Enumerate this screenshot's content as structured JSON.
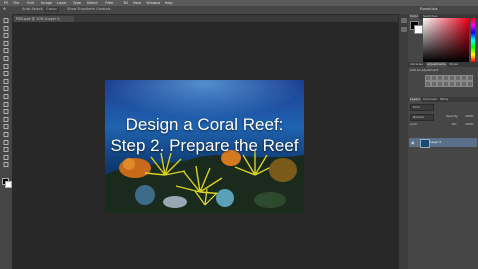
{
  "app": {
    "menu_items": [
      "PS",
      "File",
      "Edit",
      "Image",
      "Layer",
      "Type",
      "Select",
      "Filter",
      "3D",
      "View",
      "Window",
      "Help"
    ],
    "workspace_label": "Essentials"
  },
  "options_bar": {
    "auto_select_label": "Auto-Select:",
    "auto_select_value": "Group",
    "transform_controls_label": "Show Transform Controls"
  },
  "document": {
    "tab_label": "PSD.psd @ 10% (Layer 0, RGB/8*)",
    "overlay_title_line1": "Design a Coral Reef:",
    "overlay_title_line2": "Step 2. Prepare the Reef"
  },
  "panels": {
    "color_tabs": [
      "Color",
      "Swatches"
    ],
    "adjustments_tabs": [
      "Libraries",
      "Adjustments",
      "Styles"
    ],
    "adjustments_add_label": "Add an adjustment",
    "layers_tabs": [
      "Layers",
      "Channels",
      "Paths"
    ],
    "kind_label": "Kind",
    "blend_mode": "Normal",
    "opacity_label": "Opacity:",
    "opacity_value": "100%",
    "lock_label": "Lock:",
    "fill_label": "Fill:",
    "fill_value": "100%",
    "layer_name": "Layer 0"
  }
}
